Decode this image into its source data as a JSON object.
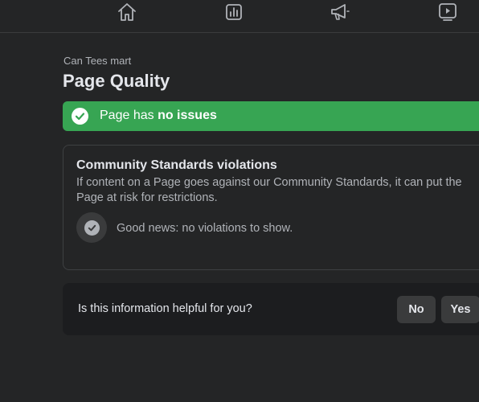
{
  "nav": {
    "items": [
      {
        "icon": "home-icon"
      },
      {
        "icon": "insights-icon"
      },
      {
        "icon": "megaphone-icon"
      },
      {
        "icon": "video-icon"
      }
    ]
  },
  "header": {
    "page_name": "Can Tees mart",
    "title": "Page Quality"
  },
  "status": {
    "prefix": "Page has ",
    "emphasis": "no issues",
    "color": "#37a553"
  },
  "violations": {
    "title": "Community Standards violations",
    "description": "If content on a Page goes against our Community Standards, it can put the Page at risk for restrictions.",
    "empty_message": "Good news: no violations to show."
  },
  "feedback": {
    "question": "Is this information helpful for you?",
    "no_label": "No",
    "yes_label": "Yes"
  }
}
